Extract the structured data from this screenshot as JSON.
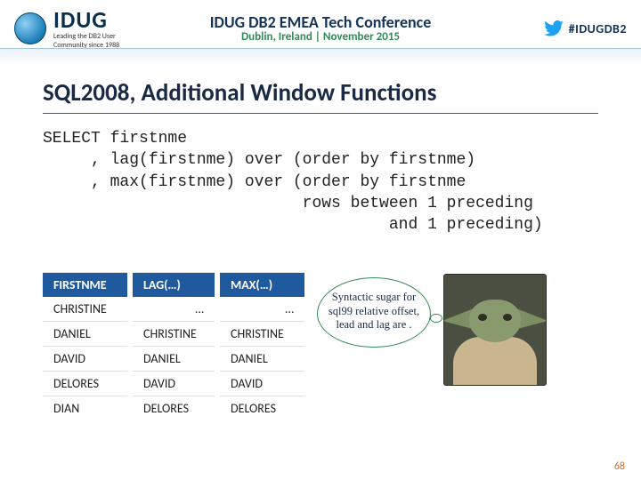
{
  "header": {
    "logo_name": "IDUG",
    "logo_tag1": "Leading the DB2 User",
    "logo_tag2": "Community since 1988",
    "conf_title": "IDUG DB2 EMEA Tech Conference",
    "conf_sub": "Dublin, Ireland  |  November 2015",
    "hashtag": "#IDUGDB2"
  },
  "title": "SQL2008, Additional Window Functions",
  "sql": "SELECT firstnme\n     , lag(firstnme) over (order by firstnme)\n     , max(firstnme) over (order by firstnme\n                           rows between 1 preceding\n                                    and 1 preceding)",
  "table": {
    "headers": [
      "FIRSTNME",
      "LAG(…)",
      "MAX(…)"
    ],
    "rows": [
      [
        "CHRISTINE",
        "…",
        "…"
      ],
      [
        "DANIEL",
        "CHRISTINE",
        "CHRISTINE"
      ],
      [
        "DAVID",
        "DANIEL",
        "DANIEL"
      ],
      [
        "DELORES",
        "DAVID",
        "DAVID"
      ],
      [
        "DIAN",
        "DELORES",
        "DELORES"
      ]
    ]
  },
  "bubble": "Syntactic sugar for sql99 relative offset, lead and lag are .",
  "page_number": "68",
  "chart_data": {
    "type": "table",
    "title": "SQL2008, Additional Window Functions",
    "columns": [
      "FIRSTNME",
      "LAG(…)",
      "MAX(…)"
    ],
    "rows": [
      [
        "CHRISTINE",
        null,
        null
      ],
      [
        "DANIEL",
        "CHRISTINE",
        "CHRISTINE"
      ],
      [
        "DAVID",
        "DANIEL",
        "DANIEL"
      ],
      [
        "DELORES",
        "DAVID",
        "DAVID"
      ],
      [
        "DIAN",
        "DELORES",
        "DELORES"
      ]
    ]
  }
}
